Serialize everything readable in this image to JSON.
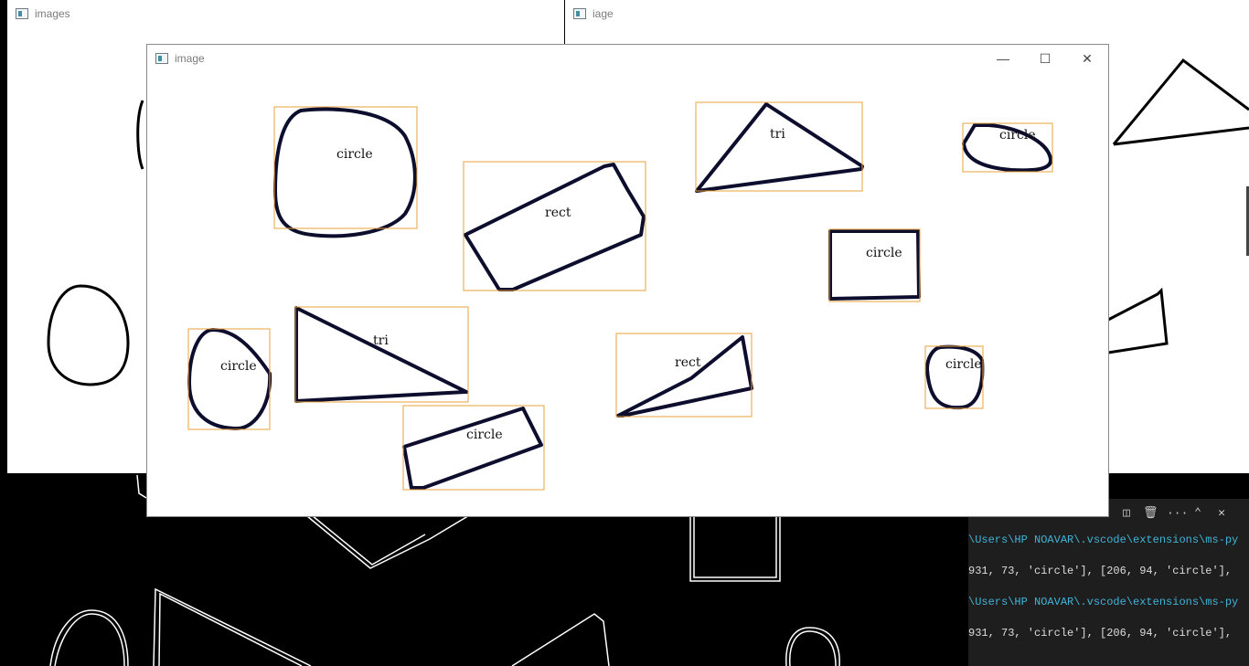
{
  "windows": {
    "images": {
      "title": "images"
    },
    "iage": {
      "title": "iage"
    },
    "image": {
      "title": "image",
      "controls": {
        "minimize": "—",
        "maximize": "☐",
        "close": "✕"
      },
      "shapes": [
        {
          "label": "circle"
        },
        {
          "label": "rect"
        },
        {
          "label": "tri"
        },
        {
          "label": "circle"
        },
        {
          "label": "circle"
        },
        {
          "label": "circle"
        },
        {
          "label": "tri"
        },
        {
          "label": "rect"
        },
        {
          "label": "circle"
        },
        {
          "label": "circle"
        }
      ]
    }
  },
  "terminal": {
    "toolbar": {
      "split": "◫",
      "trash": "🗑",
      "more": "···",
      "maximize": "⌃",
      "close": "✕"
    },
    "lines": [
      {
        "text": "\\Users\\HP NOAVAR\\.vscode\\extensions\\ms-py"
      },
      {
        "text": "931, 73, 'circle'], [206, 94, 'circle'],"
      },
      {
        "text": "\\Users\\HP NOAVAR\\.vscode\\extensions\\ms-py"
      },
      {
        "text": "931, 73, 'circle'], [206, 94, 'circle'],"
      }
    ]
  },
  "colors": {
    "box": "#e8a23a",
    "contour": "#0d0d2e",
    "edges": "#ffffff",
    "terminal_path": "#3fb4d8"
  }
}
